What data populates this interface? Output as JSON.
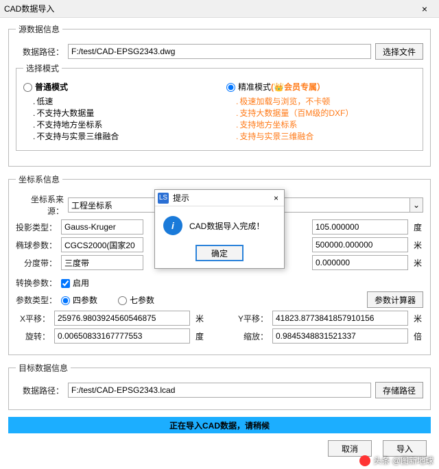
{
  "window": {
    "title": "CAD数据导入"
  },
  "source": {
    "legend": "源数据信息",
    "path_label": "数据路径：",
    "path_value": "F:/test/CAD-EPSG2343.dwg",
    "browse_btn": "选择文件",
    "mode_legend": "选择模式",
    "mode_normal": {
      "title": "普通模式",
      "items": [
        "低速",
        "不支持大数据量",
        "不支持地方坐标系",
        "不支持与实景三维融合"
      ]
    },
    "mode_precise": {
      "title_prefix": "精准模式",
      "title_suffix": "(👑会员专属）",
      "items": [
        "极速加载与浏览，不卡顿",
        "支持大数据量（百M级的DXF）",
        "支持地方坐标系",
        "支持与实景三维融合"
      ]
    }
  },
  "cs": {
    "legend": "坐标系信息",
    "src_label": "坐标系来源：",
    "src_value": "工程坐标系",
    "proj_label": "投影类型：",
    "proj_value": "Gauss-Kruger",
    "right1_value": "105.000000",
    "ellip_label": "椭球参数：",
    "ellip_value": "CGCS2000(国家20",
    "right2_value": "500000.000000",
    "zone_label": "分度带：",
    "zone_value": "三度带",
    "right3_value": "0.000000",
    "unit_deg": "度",
    "unit_m": "米",
    "conv_label": "转换参数：",
    "conv_enable": "启用",
    "paramtype_label": "参数类型：",
    "paramtype_4": "四参数",
    "paramtype_7": "七参数",
    "calc_btn": "参数计算器",
    "xshift_label": "X平移：",
    "xshift_value": "25976.9803924560546875",
    "yshift_label": "Y平移：",
    "yshift_value": "41823.8773841857910156",
    "rot_label": "旋转：",
    "rot_value": "0.00650833167777553",
    "scale_label": "缩放：",
    "scale_value": "0.9845348831521337",
    "unit_times": "倍"
  },
  "target": {
    "legend": "目标数据信息",
    "path_label": "数据路径：",
    "path_value": "F:/test/CAD-EPSG2343.lcad",
    "save_btn": "存储路径"
  },
  "progress": {
    "text": "正在导入CAD数据，请稍候"
  },
  "footer": {
    "cancel": "取消",
    "import": "导入"
  },
  "modal": {
    "title": "提示",
    "message": "CAD数据导入完成！",
    "ok": "确定"
  },
  "watermark": {
    "text": "头条 @图新地球"
  }
}
